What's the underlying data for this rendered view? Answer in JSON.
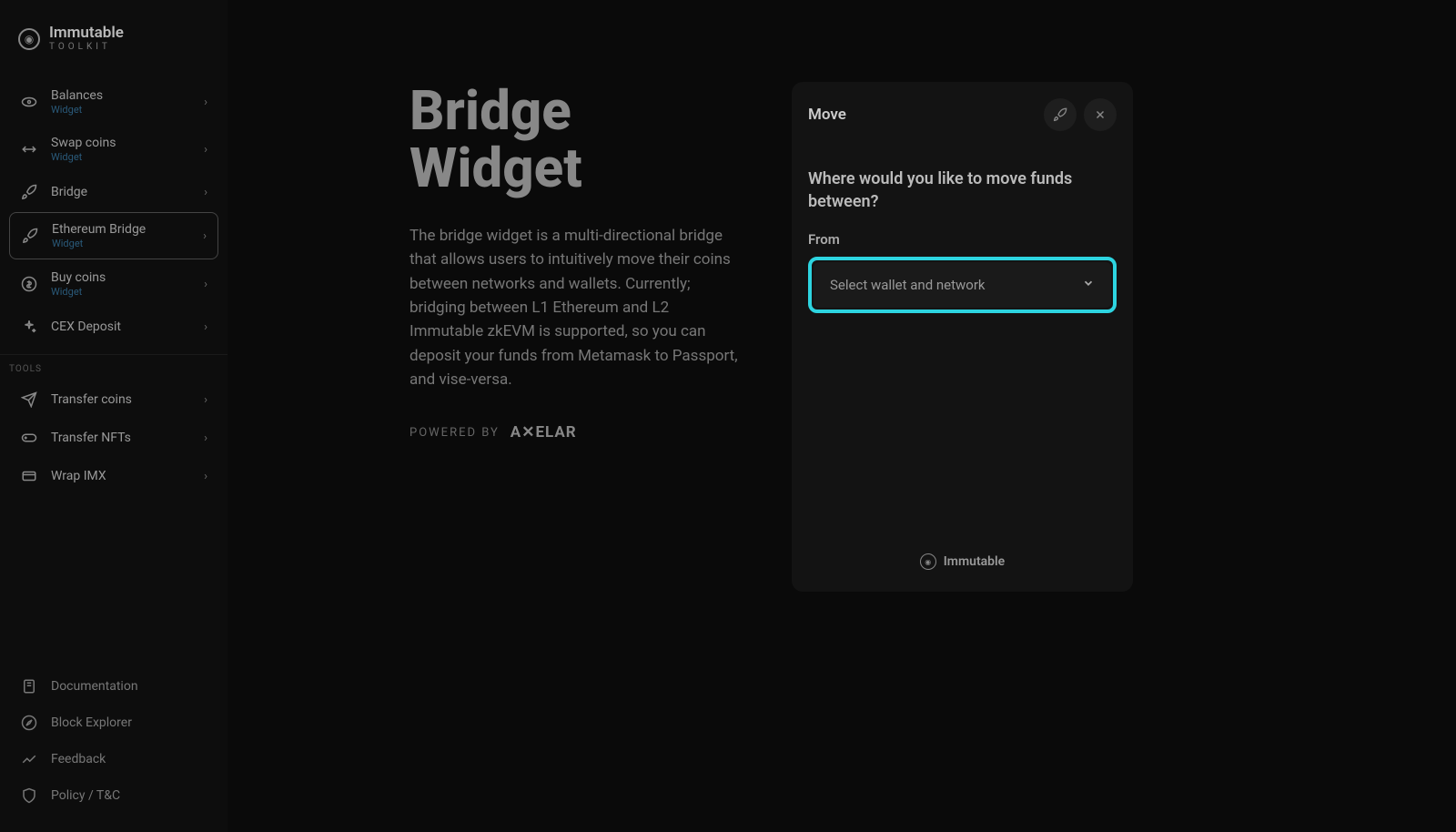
{
  "brand": {
    "name": "Immutable",
    "subtitle": "TOOLKIT"
  },
  "sidebar": {
    "nav": [
      {
        "label": "Balances",
        "sublabel": "Widget",
        "icon": "eye-icon"
      },
      {
        "label": "Swap coins",
        "sublabel": "Widget",
        "icon": "swap-icon"
      },
      {
        "label": "Bridge",
        "sublabel": "",
        "icon": "rocket-icon"
      },
      {
        "label": "Ethereum Bridge",
        "sublabel": "Widget",
        "icon": "rocket-icon",
        "active": true
      },
      {
        "label": "Buy coins",
        "sublabel": "Widget",
        "icon": "dollar-icon"
      },
      {
        "label": "CEX Deposit",
        "sublabel": "",
        "icon": "sparkle-icon"
      }
    ],
    "tools_header": "TOOLS",
    "tools": [
      {
        "label": "Transfer coins",
        "icon": "send-icon"
      },
      {
        "label": "Transfer NFTs",
        "icon": "gamepad-icon"
      },
      {
        "label": "Wrap IMX",
        "icon": "card-icon"
      }
    ],
    "footer": [
      {
        "label": "Documentation",
        "icon": "doc-icon"
      },
      {
        "label": "Block Explorer",
        "icon": "compass-icon"
      },
      {
        "label": "Feedback",
        "icon": "chart-icon"
      },
      {
        "label": "Policy / T&C",
        "icon": "shield-icon"
      }
    ]
  },
  "page": {
    "title": "Bridge Widget",
    "description": "The bridge widget is a multi-directional bridge that allows users to intuitively move their coins between networks and wallets. Currently; bridging between L1 Ethereum and L2 Immutable zkEVM is supported, so you can deposit your funds from Metamask to Passport, and vise-versa.",
    "powered_by_label": "POWERED BY",
    "powered_by_brand": "A✕ELAR"
  },
  "widget": {
    "title": "Move",
    "question": "Where would you like to move funds between?",
    "from_label": "From",
    "select_placeholder": "Select wallet and network",
    "footer_brand": "Immutable"
  }
}
